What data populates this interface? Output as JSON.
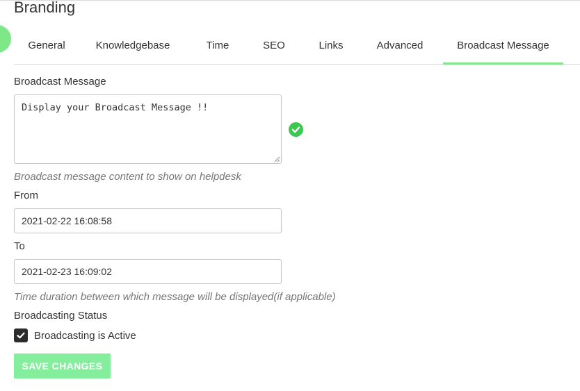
{
  "page": {
    "title": "Branding"
  },
  "tabs": [
    {
      "label": "General"
    },
    {
      "label": "Knowledgebase"
    },
    {
      "label": "Time"
    },
    {
      "label": "SEO"
    },
    {
      "label": "Links"
    },
    {
      "label": "Advanced"
    },
    {
      "label": "Broadcast Message",
      "active": true
    }
  ],
  "broadcast": {
    "label": "Broadcast Message",
    "value": "Display your Broadcast Message !!",
    "hint": "Broadcast message content to show on helpdesk",
    "status_icon": "check-circle-icon"
  },
  "from": {
    "label": "From",
    "value": "2021-02-22 16:08:58"
  },
  "to": {
    "label": "To",
    "value": "2021-02-23 16:09:02"
  },
  "duration_hint": "Time duration between which message will be displayed(if applicable)",
  "status": {
    "label": "Broadcasting Status",
    "checkbox_label": "Broadcasting is Active",
    "checked": true
  },
  "actions": {
    "save_label": "SAVE CHANGES"
  },
  "colors": {
    "accent": "#7ee787",
    "button": "#85ee9c",
    "checkbox": "#2b2b2b",
    "success": "#3cc84e"
  }
}
